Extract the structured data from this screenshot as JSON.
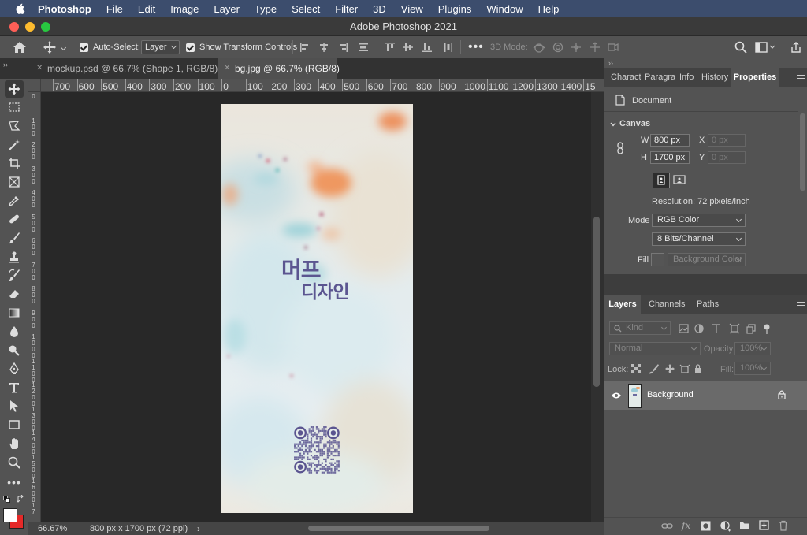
{
  "menubar": {
    "app": "Photoshop",
    "items": [
      "File",
      "Edit",
      "Image",
      "Layer",
      "Type",
      "Select",
      "Filter",
      "3D",
      "View",
      "Plugins",
      "Window",
      "Help"
    ]
  },
  "window": {
    "title": "Adobe Photoshop 2021"
  },
  "options_bar": {
    "auto_select_label": "Auto-Select:",
    "auto_select_value": "Layer",
    "show_transform_label": "Show Transform Controls",
    "mode_3d_label": "3D Mode:"
  },
  "tabs": [
    {
      "label": "mockup.psd @ 66.7% (Shape 1, RGB/8) *"
    },
    {
      "label": "bg.jpg @ 66.7% (RGB/8)"
    }
  ],
  "ruler_h": [
    "700",
    "600",
    "500",
    "400",
    "300",
    "200",
    "100",
    "0",
    "100",
    "200",
    "300",
    "400",
    "500",
    "600",
    "700",
    "800",
    "900",
    "1000",
    "1100",
    "1200",
    "1300",
    "1400",
    "15"
  ],
  "ruler_v": [
    "0",
    "1 0 0",
    "2 0 0",
    "3 0 0",
    "4 0 0",
    "5 0 0",
    "6 0 0",
    "7 0 0",
    "8 0 0",
    "9 0 0",
    "1 0 0 0",
    "1 1 0 0",
    "1 2 0 0",
    "1 3 0 0",
    "1 4 0 0",
    "1 5 0 0",
    "1 6 0 0",
    "1 7"
  ],
  "document": {
    "logo_line1": "머프",
    "logo_line2": "디자인",
    "accent_color": "#5b5590"
  },
  "status": {
    "zoom": "66.67%",
    "info": "800 px x 1700 px (72 ppi)",
    "arrow": "›"
  },
  "properties_panel": {
    "tabs": [
      "Charact",
      "Paragra",
      "Info",
      "History",
      "Properties"
    ],
    "doc_label": "Document",
    "section": "Canvas",
    "w_label": "W",
    "w_value": "800 px",
    "h_label": "H",
    "h_value": "1700 px",
    "x_label": "X",
    "x_value": "0 px",
    "y_label": "Y",
    "y_value": "0 px",
    "resolution": "Resolution: 72 pixels/inch",
    "mode_label": "Mode",
    "mode_value": "RGB Color",
    "bits_value": "8 Bits/Channel",
    "fill_label": "Fill",
    "fill_value": "Background Color"
  },
  "layers_panel": {
    "tabs": [
      "Layers",
      "Channels",
      "Paths"
    ],
    "kind": "Kind",
    "blend": "Normal",
    "opacity_label": "Opacity:",
    "opacity_value": "100%",
    "lock_label": "Lock:",
    "fill_label": "Fill:",
    "fill_value": "100%",
    "layer_name": "Background"
  }
}
